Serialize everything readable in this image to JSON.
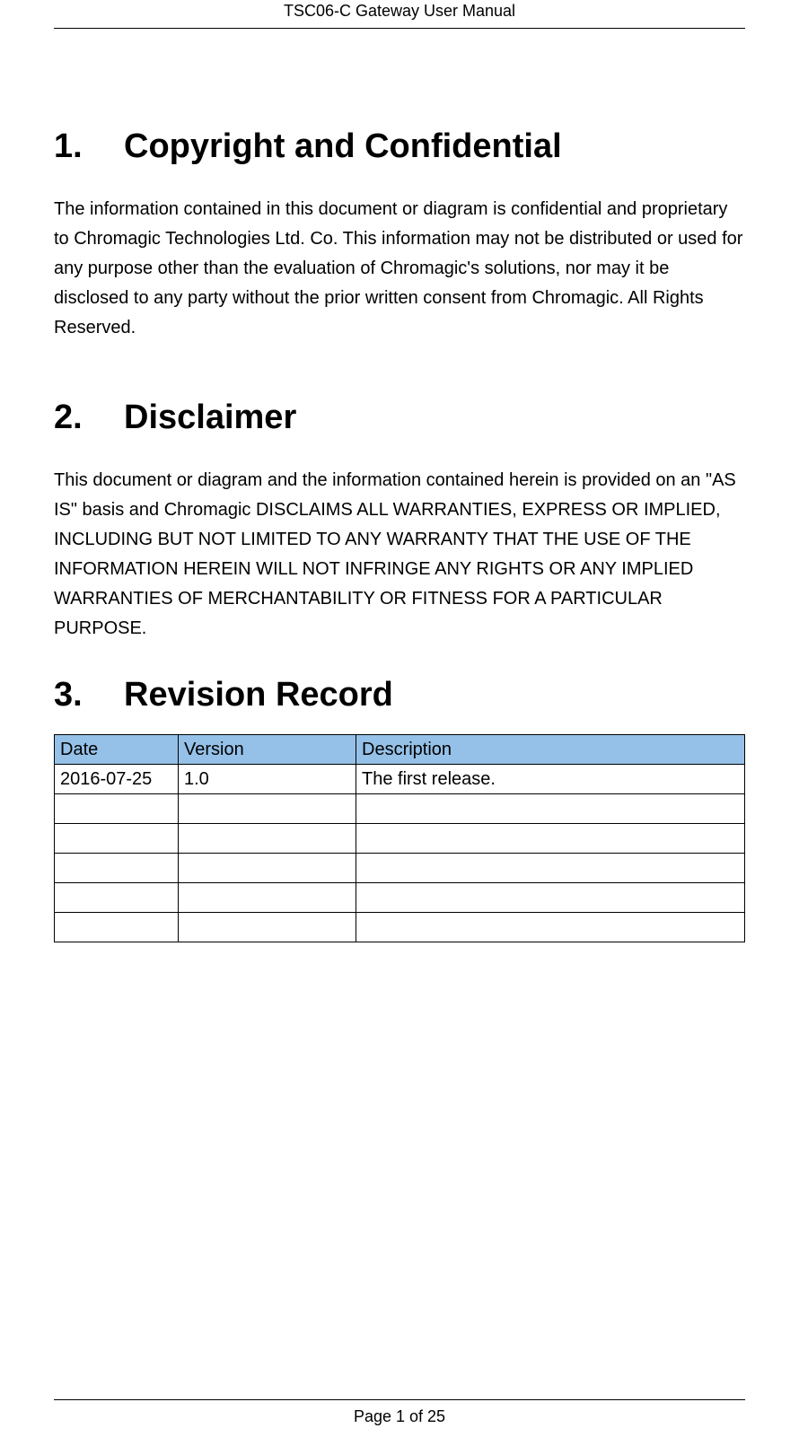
{
  "header": {
    "title": "TSC06-C Gateway User Manual"
  },
  "sections": {
    "s1": {
      "num": "1.",
      "title": "Copyright and Confidential",
      "body": "The information contained in this document or diagram is confidential and proprietary to Chromagic Technologies Ltd. Co. This information may not be distributed or used for any purpose other than the evaluation of Chromagic's solutions, nor may it be disclosed to any party without the prior written consent from Chromagic. All Rights Reserved."
    },
    "s2": {
      "num": "2.",
      "title": "Disclaimer",
      "body": "This document or diagram and the information contained herein is provided on an \"AS IS\" basis and Chromagic DISCLAIMS ALL WARRANTIES, EXPRESS OR IMPLIED, INCLUDING BUT NOT LIMITED TO ANY WARRANTY THAT THE USE OF THE INFORMATION HEREIN WILL NOT INFRINGE ANY RIGHTS OR ANY IMPLIED WARRANTIES OF MERCHANTABILITY OR FITNESS FOR A PARTICULAR PURPOSE."
    },
    "s3": {
      "num": "3.",
      "title": "Revision Record"
    }
  },
  "table": {
    "headers": [
      "Date",
      "Version",
      "Description"
    ],
    "rows": [
      [
        "2016-07-25",
        "1.0",
        "The first release."
      ],
      [
        "",
        "",
        ""
      ],
      [
        "",
        "",
        ""
      ],
      [
        "",
        "",
        ""
      ],
      [
        "",
        "",
        ""
      ],
      [
        "",
        "",
        ""
      ]
    ]
  },
  "footer": {
    "text": "Page 1 of 25"
  }
}
